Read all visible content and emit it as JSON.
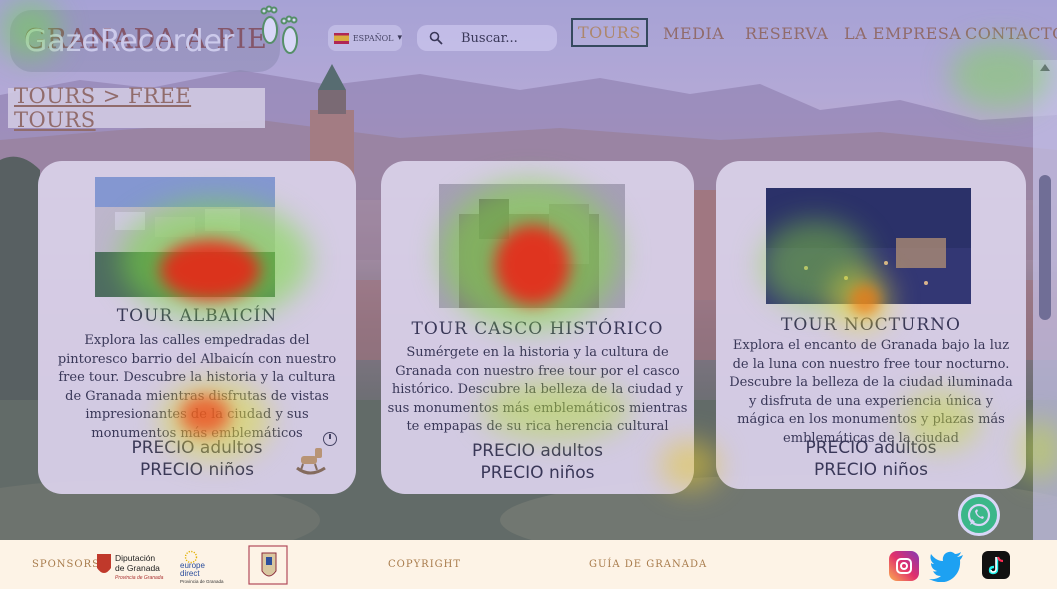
{
  "logo": {
    "brand": "GRANADA A PIE",
    "overlay": "GazeRecorder"
  },
  "language": {
    "label": "ESPAÑOL",
    "caret": "▾",
    "flag": "spain-flag"
  },
  "search": {
    "label": "Buscar..."
  },
  "nav": {
    "items": [
      "TOURS",
      "MEDIA",
      "RESERVA",
      "LA EMPRESA",
      "CONTACTO"
    ],
    "active": "TOURS"
  },
  "breadcrumb": "TOURS > FREE TOURS",
  "cards": [
    {
      "title": "TOUR ALBAICÍN",
      "description": "Explora las calles empedradas del pintoresco barrio del Albaicín con nuestro free tour. Descubre la historia y la cultura de Granada mientras disfrutas de vistas impresionantes de la ciudad y sus monumentos más emblemáticos",
      "price_adults": "PRECIO adultos",
      "price_kids": "PRECIO niños"
    },
    {
      "title": "TOUR CASCO HISTÓRICO",
      "description": "Sumérgete en la historia y la cultura de Granada con nuestro free tour por el casco histórico. Descubre la belleza de la ciudad y sus monumentos más emblemáticos mientras te empapas de su rica herencia cultural",
      "price_adults": "PRECIO adultos",
      "price_kids": "PRECIO niños"
    },
    {
      "title": "TOUR NOCTURNO",
      "description": "Explora el encanto de Granada bajo la luz de la luna con nuestro free tour nocturno. Descubre la belleza de la ciudad iluminada y disfruta de una experiencia única y mágica en los monumentos y plazas más emblemáticas de la ciudad",
      "price_adults": "PRECIO adultos",
      "price_kids": "PRECIO niños"
    }
  ],
  "footer": {
    "sponsors_label": "SPONSORS",
    "diputacion": {
      "line1": "Diputación",
      "line2": "de Granada",
      "tag": "Provincia de Granada"
    },
    "europe": {
      "line1": "europe",
      "line2": "direct",
      "line3": "Provincia de Granada"
    },
    "copyright": "COPYRIGHT",
    "guide": "GUÍA DE GRANADA"
  },
  "colors": {
    "accent": "#9c6b3e",
    "card_bg": "#fdf4e8",
    "nav_active_border": "#1d3b2a"
  }
}
